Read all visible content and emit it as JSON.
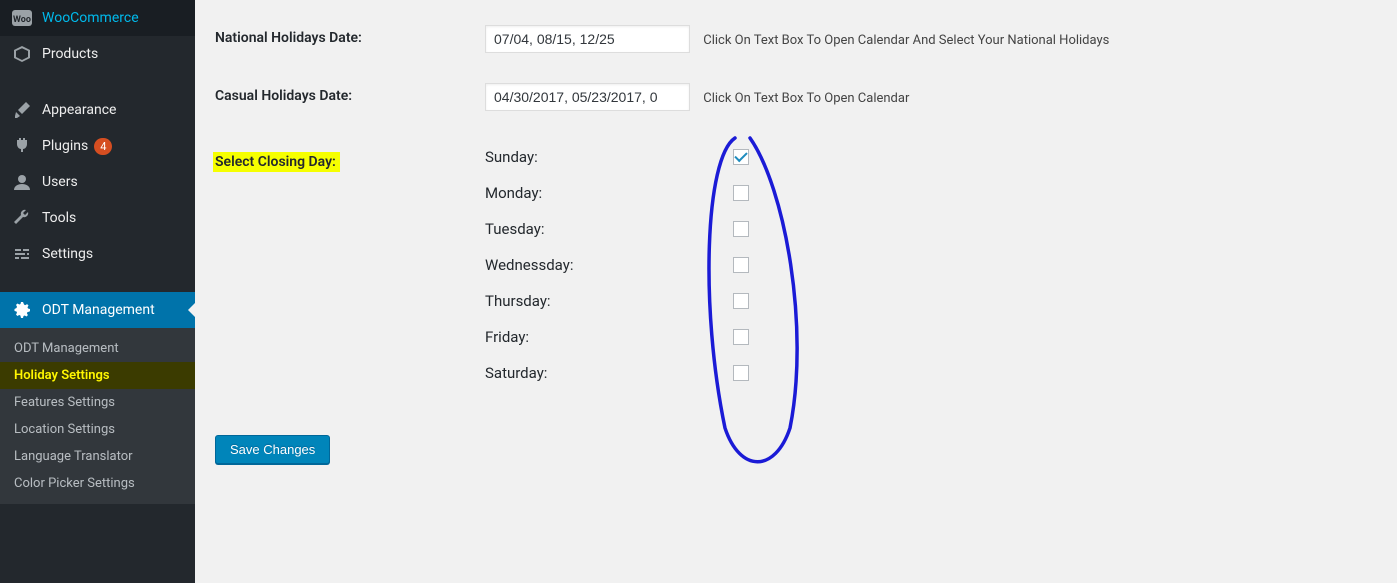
{
  "sidebar": {
    "items": [
      {
        "label": "WooCommerce",
        "icon": "woo"
      },
      {
        "label": "Products",
        "icon": "box"
      },
      {
        "label": "Appearance",
        "icon": "brush"
      },
      {
        "label": "Plugins",
        "icon": "plug",
        "badge": "4"
      },
      {
        "label": "Users",
        "icon": "user"
      },
      {
        "label": "Tools",
        "icon": "wrench"
      },
      {
        "label": "Settings",
        "icon": "sliders"
      }
    ],
    "current": {
      "label": "ODT Management"
    },
    "submenu": [
      {
        "label": "ODT Management"
      },
      {
        "label": "Holiday Settings",
        "active": true
      },
      {
        "label": "Features Settings"
      },
      {
        "label": "Location Settings"
      },
      {
        "label": "Language Translator"
      },
      {
        "label": "Color Picker Settings"
      }
    ]
  },
  "page": {
    "title": "Holiday Settings",
    "national": {
      "label": "National Holidays Date:",
      "value": "07/04, 08/15, 12/25",
      "hint": "Click On Text Box To Open Calendar And Select Your National Holidays"
    },
    "casual": {
      "label": "Casual Holidays Date:",
      "value": "04/30/2017, 05/23/2017, 0",
      "hint": "Click On Text Box To Open Calendar"
    },
    "closing": {
      "label": "Select Closing Day:",
      "days": [
        {
          "label": "Sunday:",
          "checked": true
        },
        {
          "label": "Monday:",
          "checked": false
        },
        {
          "label": "Tuesday:",
          "checked": false
        },
        {
          "label": "Wednessday:",
          "checked": false
        },
        {
          "label": "Thursday:",
          "checked": false
        },
        {
          "label": "Friday:",
          "checked": false
        },
        {
          "label": "Saturday:",
          "checked": false
        }
      ]
    },
    "save_label": "Save Changes"
  }
}
